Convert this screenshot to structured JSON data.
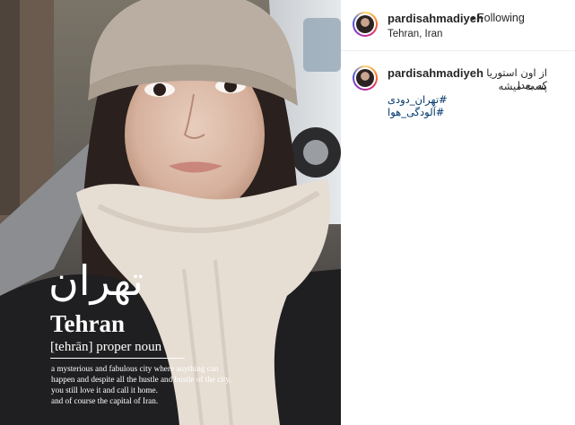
{
  "post": {
    "username": "pardisahmadiyeh",
    "follow_separator": "•",
    "follow_label": "Following",
    "location": "Tehran, Iran"
  },
  "caption": {
    "username": "pardisahmadiyeh",
    "text_line1": "از اون استوریا که بعدا",
    "text_line2": "پست میشه",
    "hashtags": [
      "#تهران_دودی",
      "#آلودگی_هوا"
    ]
  },
  "photo_overlay": {
    "word_fa": "تهران",
    "word": "Tehran",
    "pronunciation_pos": "[tehrān] proper noun",
    "definition": [
      "a mysterious and fabulous city where anything can",
      "happen and despite all the hustle and bustle of the city,",
      "you still love it and call it home.",
      "and of course the capital of Iran."
    ]
  },
  "colors": {
    "hashtag": "#00376b",
    "text": "#262626",
    "divider": "#efefef"
  }
}
